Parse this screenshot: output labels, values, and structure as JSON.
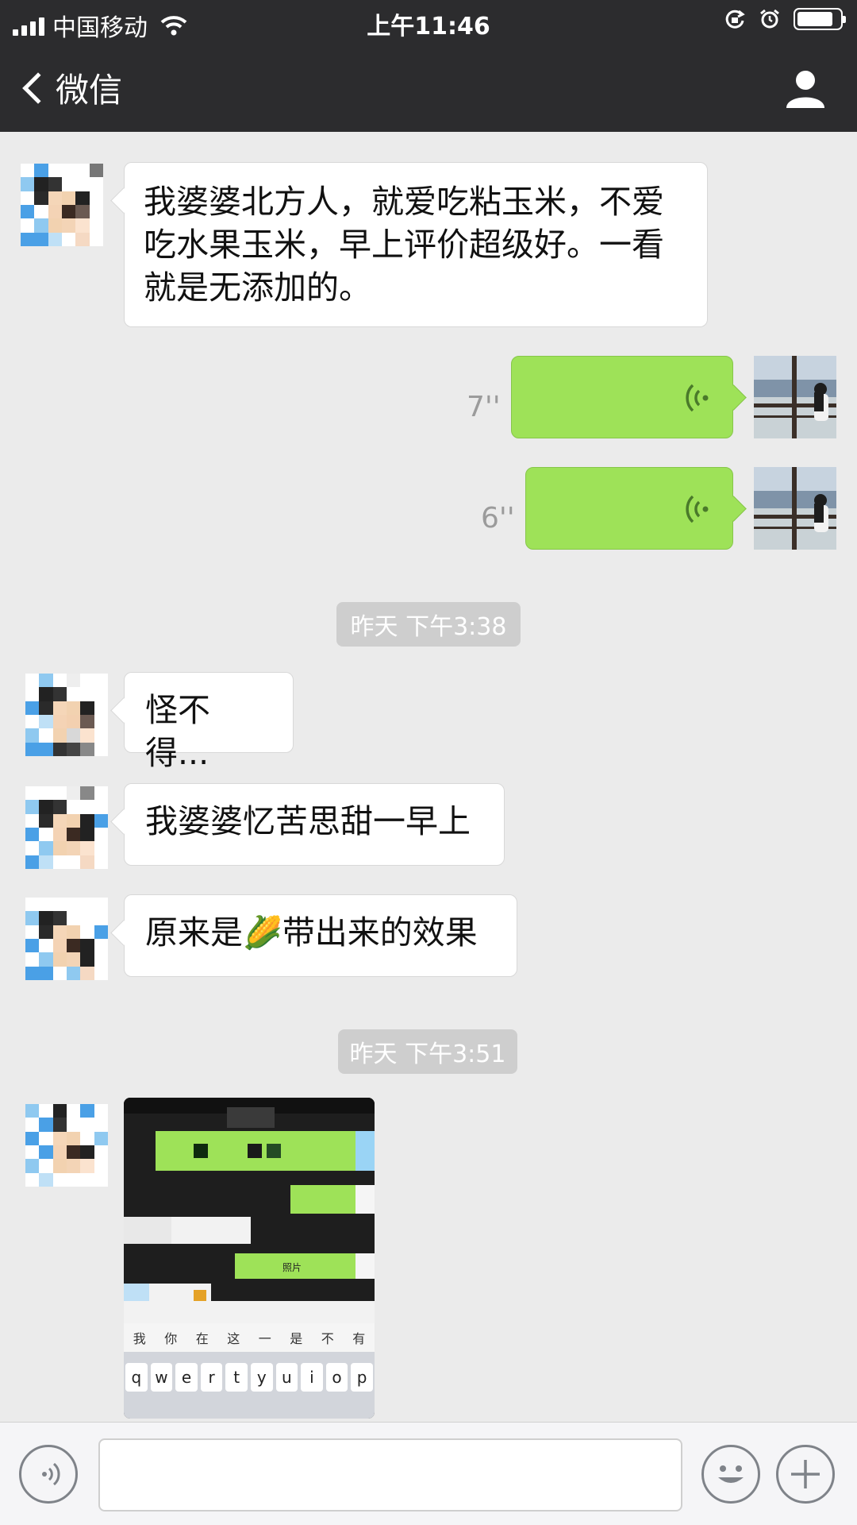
{
  "status_bar": {
    "carrier": "中国移动",
    "time": "上午11:46",
    "battery_level": 0.85
  },
  "nav": {
    "back_label": "微信",
    "chat_title": "",
    "profile_icon": "person-icon"
  },
  "messages": [
    {
      "type": "text",
      "side": "left",
      "text": "我婆婆北方人，就爱吃粘玉米，不爱吃水果玉米，早上评价超级好。一看就是无添加的。"
    },
    {
      "type": "voice",
      "side": "right",
      "duration": "7''"
    },
    {
      "type": "voice",
      "side": "right",
      "duration": "6''"
    },
    {
      "type": "timestamp",
      "text": "昨天 下午3:38"
    },
    {
      "type": "text",
      "side": "left",
      "text": "怪不得..."
    },
    {
      "type": "text",
      "side": "left",
      "text": "我婆婆忆苦思甜一早上"
    },
    {
      "type": "text",
      "side": "left",
      "text_before": "原来是",
      "emoji": "🌽",
      "text_after": "带出来的效果"
    },
    {
      "type": "timestamp",
      "text": "昨天 下午3:51"
    },
    {
      "type": "image",
      "side": "left"
    }
  ],
  "shared_image": {
    "candidates": [
      "我",
      "你",
      "在",
      "这",
      "一",
      "是",
      "不",
      "有"
    ],
    "keys": [
      "q",
      "w",
      "e",
      "r",
      "t",
      "y",
      "u",
      "i",
      "o",
      "p"
    ],
    "bubble_texts": [
      "照片"
    ]
  },
  "input_bar": {
    "voice_icon": "voice-toggle-icon",
    "emoji_icon": "emoji-icon",
    "plus_icon": "plus-icon",
    "value": ""
  },
  "colors": {
    "nav_bg": "#2c2c2e",
    "chat_bg": "#ebebeb",
    "voice_bubble": "#9ee258",
    "timestamp_chip": "#cecece"
  }
}
